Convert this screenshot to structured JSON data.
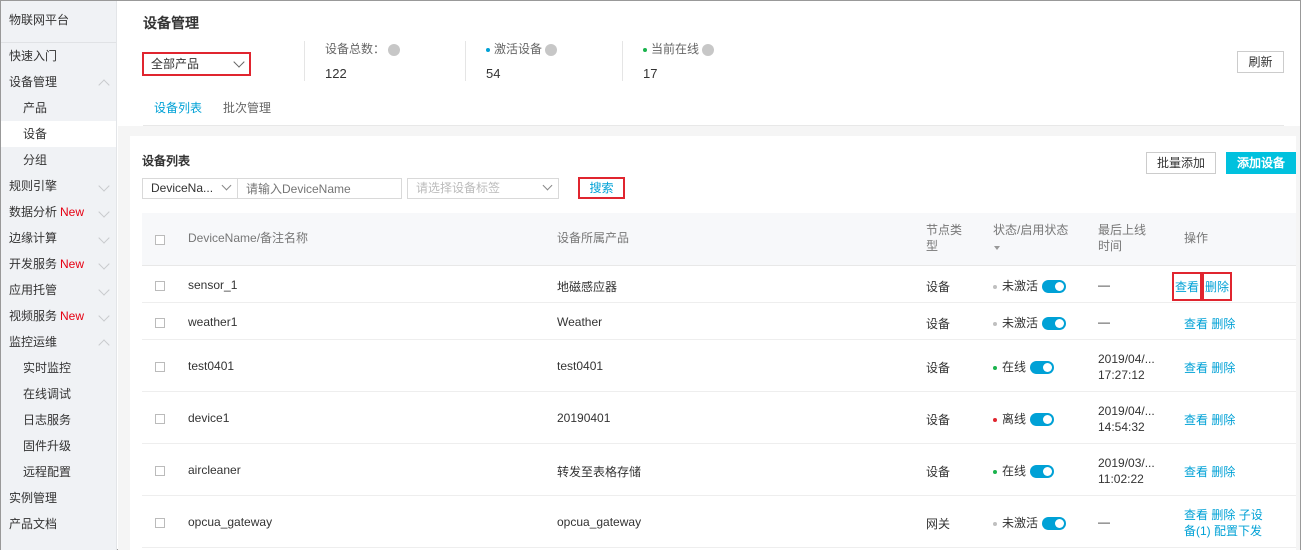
{
  "sidebar": {
    "brand": "物联网平台",
    "items": [
      {
        "label": "快速入门",
        "level": 0,
        "chevron": "none",
        "new": ""
      },
      {
        "label": "设备管理",
        "level": 0,
        "chevron": "up",
        "new": ""
      },
      {
        "label": "产品",
        "level": 1,
        "chevron": "none",
        "new": ""
      },
      {
        "label": "设备",
        "level": 1,
        "chevron": "none",
        "new": "",
        "active": true
      },
      {
        "label": "分组",
        "level": 1,
        "chevron": "none",
        "new": ""
      },
      {
        "label": "规则引擎",
        "level": 0,
        "chevron": "down",
        "new": ""
      },
      {
        "label": "数据分析",
        "level": 0,
        "chevron": "down",
        "new": "New"
      },
      {
        "label": "边缘计算",
        "level": 0,
        "chevron": "down",
        "new": ""
      },
      {
        "label": "开发服务",
        "level": 0,
        "chevron": "down",
        "new": "New"
      },
      {
        "label": "应用托管",
        "level": 0,
        "chevron": "down",
        "new": ""
      },
      {
        "label": "视频服务",
        "level": 0,
        "chevron": "down",
        "new": "New"
      },
      {
        "label": "监控运维",
        "level": 0,
        "chevron": "up",
        "new": ""
      },
      {
        "label": "实时监控",
        "level": 2,
        "chevron": "none",
        "new": ""
      },
      {
        "label": "在线调试",
        "level": 2,
        "chevron": "none",
        "new": ""
      },
      {
        "label": "日志服务",
        "level": 2,
        "chevron": "none",
        "new": ""
      },
      {
        "label": "固件升级",
        "level": 2,
        "chevron": "none",
        "new": ""
      },
      {
        "label": "远程配置",
        "level": 2,
        "chevron": "none",
        "new": ""
      },
      {
        "label": "实例管理",
        "level": 0,
        "chevron": "none",
        "new": ""
      },
      {
        "label": "产品文档",
        "level": 0,
        "chevron": "none",
        "new": ""
      }
    ]
  },
  "header": {
    "title": "设备管理",
    "product_select": "全部产品",
    "refresh_label": "刷新",
    "stats": [
      {
        "label": "设备总数：",
        "value": "122",
        "dot_color": ""
      },
      {
        "label": "激活设备",
        "value": "54",
        "dot_color": "#00a1d6"
      },
      {
        "label": "当前在线",
        "value": "17",
        "dot_color": "#1ab34d"
      }
    ]
  },
  "tabs": [
    {
      "label": "设备列表",
      "active": true
    },
    {
      "label": "批次管理",
      "active": false
    }
  ],
  "list": {
    "title": "设备列表",
    "batch_add_label": "批量添加",
    "add_device_label": "添加设备",
    "filter_type_value": "DeviceNa...",
    "name_input_placeholder": "请输入DeviceName",
    "tag_select_placeholder": "请选择设备标签",
    "search_label": "搜索",
    "columns": {
      "name": "DeviceName/备注名称",
      "product": "设备所属产品",
      "node_type_1": "节点类",
      "node_type_2": "型",
      "status": "状态/启用状态",
      "last_online_1": "最后上线",
      "last_online_2": "时间",
      "actions": "操作"
    },
    "rows": [
      {
        "name": "sensor_1",
        "product": "地磁感应器",
        "node": "设备",
        "status": "未激活",
        "status_color": "#c0c0c0",
        "last1": "—",
        "last2": "",
        "view": "查看",
        "del": "删除",
        "extra1": "",
        "extra2": ""
      },
      {
        "name": "weather1",
        "product": "Weather",
        "node": "设备",
        "status": "未激活",
        "status_color": "#c0c0c0",
        "last1": "—",
        "last2": "",
        "view": "查看",
        "del": "删除",
        "extra1": "",
        "extra2": ""
      },
      {
        "name": "test0401",
        "product": "test0401",
        "node": "设备",
        "status": "在线",
        "status_color": "#1ab34d",
        "last1": "2019/04/...",
        "last2": "17:27:12",
        "view": "查看",
        "del": "删除",
        "extra1": "",
        "extra2": ""
      },
      {
        "name": "device1",
        "product": "20190401",
        "node": "设备",
        "status": "离线",
        "status_color": "#e0252f",
        "last1": "2019/04/...",
        "last2": "14:54:32",
        "view": "查看",
        "del": "删除",
        "extra1": "",
        "extra2": ""
      },
      {
        "name": "aircleaner",
        "product": "转发至表格存储",
        "node": "设备",
        "status": "在线",
        "status_color": "#1ab34d",
        "last1": "2019/03/...",
        "last2": "11:02:22",
        "view": "查看",
        "del": "删除",
        "extra1": "",
        "extra2": ""
      },
      {
        "name": "opcua_gateway",
        "product": "opcua_gateway",
        "node": "网关",
        "status": "未激活",
        "status_color": "#c0c0c0",
        "last1": "—",
        "last2": "",
        "view": "查看",
        "del": "删除",
        "extra1": "子设",
        "extra2": "备(1) 配置下发"
      }
    ]
  }
}
